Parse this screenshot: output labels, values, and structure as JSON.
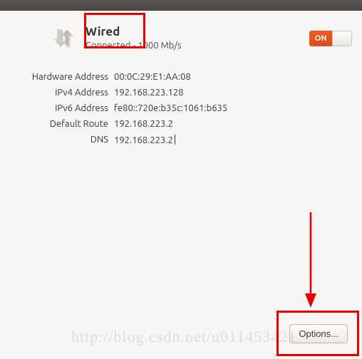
{
  "header": {
    "title": "Wired",
    "status": "Connected - 1000 Mb/s"
  },
  "switch": {
    "on_label": "ON"
  },
  "details": {
    "rows": [
      {
        "label": "Hardware Address",
        "value": "00:0C:29:E1:AA:08"
      },
      {
        "label": "IPv4 Address",
        "value": "192.168.223.128"
      },
      {
        "label": "IPv6 Address",
        "value": "fe80::720e:b35c:1061:b635"
      },
      {
        "label": "Default Route",
        "value": "192.168.223.2"
      },
      {
        "label": "DNS",
        "value": "192.168.223.2"
      }
    ]
  },
  "buttons": {
    "options": "Options..."
  },
  "watermark": "http://blog.csdn.net/u011453421"
}
